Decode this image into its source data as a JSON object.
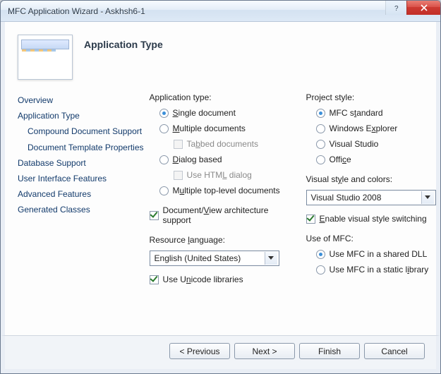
{
  "window": {
    "title": "MFC Application Wizard - Askhsh6-1"
  },
  "heading": "Application Type",
  "sidebar": {
    "items": [
      {
        "label": "Overview",
        "indent": false
      },
      {
        "label": "Application Type",
        "indent": false
      },
      {
        "label": "Compound Document Support",
        "indent": true
      },
      {
        "label": "Document Template Properties",
        "indent": true
      },
      {
        "label": "Database Support",
        "indent": false
      },
      {
        "label": "User Interface Features",
        "indent": false
      },
      {
        "label": "Advanced Features",
        "indent": false
      },
      {
        "label": "Generated Classes",
        "indent": false
      }
    ]
  },
  "app_type": {
    "label": "Application type:",
    "single": "Single document",
    "multiple": "Multiple documents",
    "tabbed": "Tabbed documents",
    "dialog": "Dialog based",
    "html": "Use HTML dialog",
    "multitop": "Multiple top-level documents",
    "docview": "Document/View architecture support"
  },
  "resource_lang": {
    "label": "Resource language:",
    "value": "English (United States)",
    "unicode": "Use Unicode libraries"
  },
  "project_style": {
    "label": "Project style:",
    "mfc": "MFC standard",
    "explorer": "Windows Explorer",
    "vs": "Visual Studio",
    "office": "Office"
  },
  "visual_style": {
    "label": "Visual style and colors:",
    "value": "Visual Studio 2008",
    "switching": "Enable visual style switching"
  },
  "use_of_mfc": {
    "label": "Use of MFC:",
    "shared": "Use MFC in a shared DLL",
    "static": "Use MFC in a static library"
  },
  "buttons": {
    "previous": "< Previous",
    "next": "Next >",
    "finish": "Finish",
    "cancel": "Cancel"
  }
}
